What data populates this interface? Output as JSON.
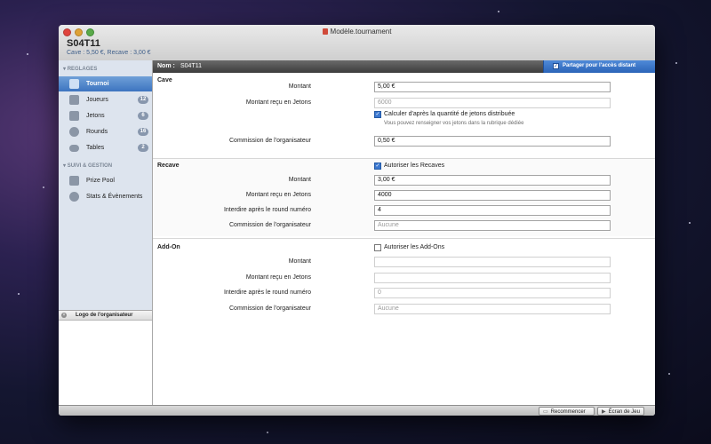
{
  "window": {
    "title": "Modèle.tournament",
    "tournament_name": "S04T11",
    "summary": "Cave : 5,50 €, Recave : 3,00 €"
  },
  "sidebar": {
    "sections": [
      {
        "label": "REGLAGES"
      },
      {
        "label": "SUIVI & GESTION"
      }
    ],
    "items": [
      {
        "label": "Tournoi",
        "icon": "tournament-icon",
        "badge": "",
        "selected": true
      },
      {
        "label": "Joueurs",
        "icon": "players-icon",
        "badge": "12"
      },
      {
        "label": "Jetons",
        "icon": "chips-icon",
        "badge": "6"
      },
      {
        "label": "Rounds",
        "icon": "clock-icon",
        "badge": "16"
      },
      {
        "label": "Tables",
        "icon": "table-icon",
        "badge": "2"
      },
      {
        "label": "Prize Pool",
        "icon": "prize-pool-icon",
        "badge": ""
      },
      {
        "label": "Stats & Évènements",
        "icon": "stats-icon",
        "badge": ""
      }
    ],
    "logo_label": "Logo de l'organisateur"
  },
  "main": {
    "name_label": "Nom :",
    "name_value": "S04T11",
    "share_label": "Partager pour l'accès distant",
    "cave": {
      "heading": "Cave",
      "montant_label": "Montant",
      "montant_value": "5,00 €",
      "jetons_label": "Montant reçu en Jetons",
      "jetons_placeholder": "6000",
      "calc_label": "Calculer d'après la quantité de jetons distribuée",
      "calc_hint": "Vous pouvez renseigner vos jetons dans la rubrique dédiée",
      "commission_label": "Commission de l'organisateur",
      "commission_value": "0,50 €"
    },
    "recave": {
      "heading": "Recave",
      "autoriser_label": "Autoriser les Recaves",
      "montant_label": "Montant",
      "montant_value": "3,00 €",
      "jetons_label": "Montant reçu en Jetons",
      "jetons_value": "4000",
      "interdire_label": "Interdire après le round numéro",
      "interdire_value": "4",
      "commission_label": "Commission de l'organisateur",
      "commission_placeholder": "Aucune"
    },
    "addon": {
      "heading": "Add-On",
      "autoriser_label": "Autoriser les Add-Ons",
      "montant_label": "Montant",
      "jetons_label": "Montant reçu en Jetons",
      "interdire_label": "Interdire après le round numéro",
      "interdire_placeholder": "0",
      "commission_label": "Commission de l'organisateur",
      "commission_placeholder": "Aucune"
    }
  },
  "footer": {
    "restart_label": "Recommencer",
    "game_screen_label": "Écran de Jeu"
  }
}
